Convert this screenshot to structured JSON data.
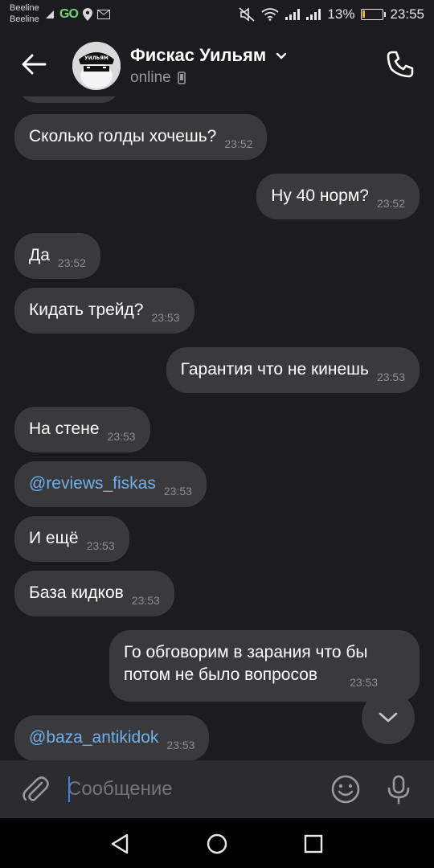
{
  "status_bar": {
    "carrier_1": "Beeline",
    "carrier_2": "Beeline",
    "go_label": "GO",
    "battery_percent": "13%",
    "battery_level": 0.13,
    "time": "23:55"
  },
  "header": {
    "contact_name": "Фискас Уильям",
    "status": "online",
    "avatar_text": "УИЛЬЯМ"
  },
  "messages": [
    {
      "text": "Сколько голды хочешь?",
      "time": "23:52",
      "direction": "in"
    },
    {
      "text": "Ну 40 норм?",
      "time": "23:52",
      "direction": "out"
    },
    {
      "text": "Да",
      "time": "23:52",
      "direction": "in"
    },
    {
      "text": "Кидать трейд?",
      "time": "23:53",
      "direction": "in"
    },
    {
      "text": "Гарантия что не кинешь",
      "time": "23:53",
      "direction": "out"
    },
    {
      "text": "На стене",
      "time": "23:53",
      "direction": "in"
    },
    {
      "text": "@reviews_fiskas",
      "time": "23:53",
      "direction": "in",
      "is_link": true
    },
    {
      "text": "И ещё",
      "time": "23:53",
      "direction": "in"
    },
    {
      "text": "База кидков",
      "time": "23:53",
      "direction": "in"
    },
    {
      "text_line_1": "Го обговорим в зарания что бы",
      "text_line_2": "потом не было вопросов",
      "time": "23:53",
      "direction": "out"
    },
    {
      "text": "@baza_antikidok",
      "time": "23:53",
      "direction": "in",
      "is_link": true
    }
  ],
  "composer": {
    "placeholder": "Сообщение"
  },
  "icons": {
    "back": "arrow-left-icon",
    "phone": "phone-icon",
    "attach": "paperclip-icon",
    "emoji": "smiley-icon",
    "mic": "microphone-icon",
    "scroll": "chevron-down-icon",
    "nav_back": "triangle-back-icon",
    "nav_home": "circle-home-icon",
    "nav_recents": "square-recents-icon"
  },
  "colors": {
    "background": "#1c1c1e",
    "bubble": "#3a3a3c",
    "link": "#6fb0ec",
    "time": "#8e8e93"
  }
}
